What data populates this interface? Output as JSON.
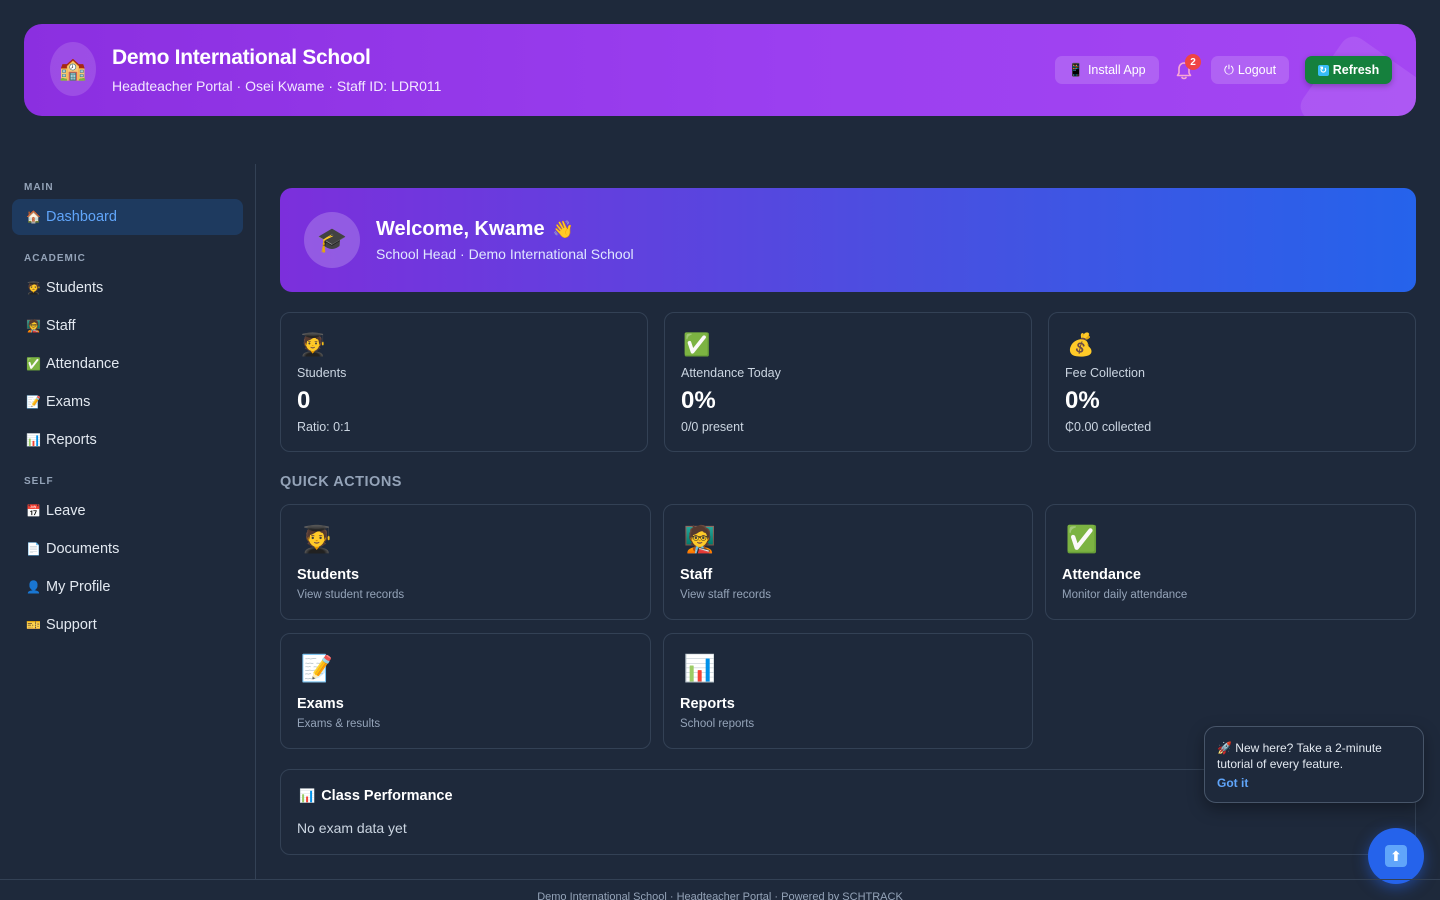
{
  "header": {
    "logo_icon": "school-icon",
    "school_name": "Demo International School",
    "subtitle": "Headteacher Portal · Osei Kwame · Staff ID: LDR011",
    "install_label": "Install App",
    "notification_count": "2",
    "logout_label": "Logout",
    "refresh_label": "Refresh"
  },
  "sidebar": {
    "sections": {
      "main": "MAIN",
      "academic": "ACADEMIC",
      "self": "SELF"
    },
    "items": {
      "dashboard": "Dashboard",
      "students": "Students",
      "staff": "Staff",
      "attendance": "Attendance",
      "exams": "Exams",
      "reports": "Reports",
      "leave": "Leave",
      "documents": "Documents",
      "profile": "My Profile",
      "support": "Support"
    }
  },
  "welcome": {
    "title": "Welcome, Kwame",
    "subtitle": "School Head · Demo International School"
  },
  "stats": {
    "students": {
      "label": "Students",
      "value": "0",
      "note": "Ratio: 0:1"
    },
    "attendance": {
      "label": "Attendance Today",
      "value": "0%",
      "note": "0/0 present"
    },
    "fees": {
      "label": "Fee Collection",
      "value": "0%",
      "note": "₵0.00 collected"
    }
  },
  "quick_actions": {
    "title": "QUICK ACTIONS",
    "students": {
      "name": "Students",
      "desc": "View student records"
    },
    "staff": {
      "name": "Staff",
      "desc": "View staff records"
    },
    "attendance": {
      "name": "Attendance",
      "desc": "Monitor daily attendance"
    },
    "exams": {
      "name": "Exams",
      "desc": "Exams & results"
    },
    "reports": {
      "name": "Reports",
      "desc": "School reports"
    }
  },
  "performance": {
    "title": "Class Performance",
    "empty": "No exam data yet"
  },
  "tutorial": {
    "message": "New here? Take a 2-minute tutorial of every feature.",
    "dismiss": "Got it"
  },
  "footer": {
    "text": "Demo International School · Headteacher Portal · Powered by SCHTRACK"
  },
  "colors": {
    "background": "#1e293b",
    "header_gradient_start": "#8b2fe0",
    "welcome_gradient_end": "#2563eb",
    "active_nav": "#60a5fa",
    "refresh_button": "#15803d",
    "badge": "#ef4444"
  }
}
